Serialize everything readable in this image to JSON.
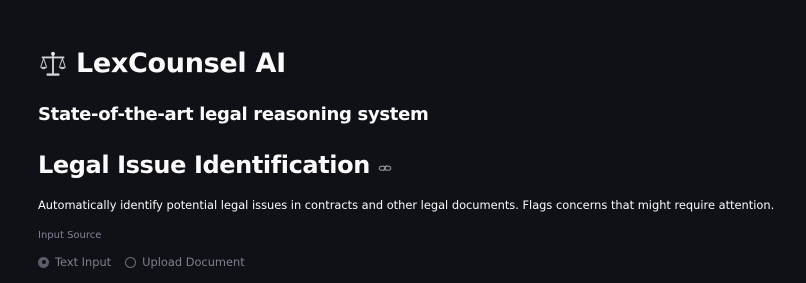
{
  "header": {
    "app_title": "LexCounsel AI",
    "app_icon": "scales-icon",
    "subtitle": "State-of-the-art legal reasoning system"
  },
  "section": {
    "title": "Legal Issue Identification",
    "anchor_icon": "link-icon",
    "description": "Automatically identify potential legal issues in contracts and other legal documents. Flags concerns that might require attention."
  },
  "input_source": {
    "label": "Input Source",
    "selected": "Text Input",
    "options": [
      {
        "label": "Text Input",
        "checked": true
      },
      {
        "label": "Upload Document",
        "checked": false
      }
    ]
  },
  "colors": {
    "background": "#0f1117",
    "text": "#fafafa",
    "muted_text": "#808495",
    "radio_checked": "#5a5d68"
  }
}
